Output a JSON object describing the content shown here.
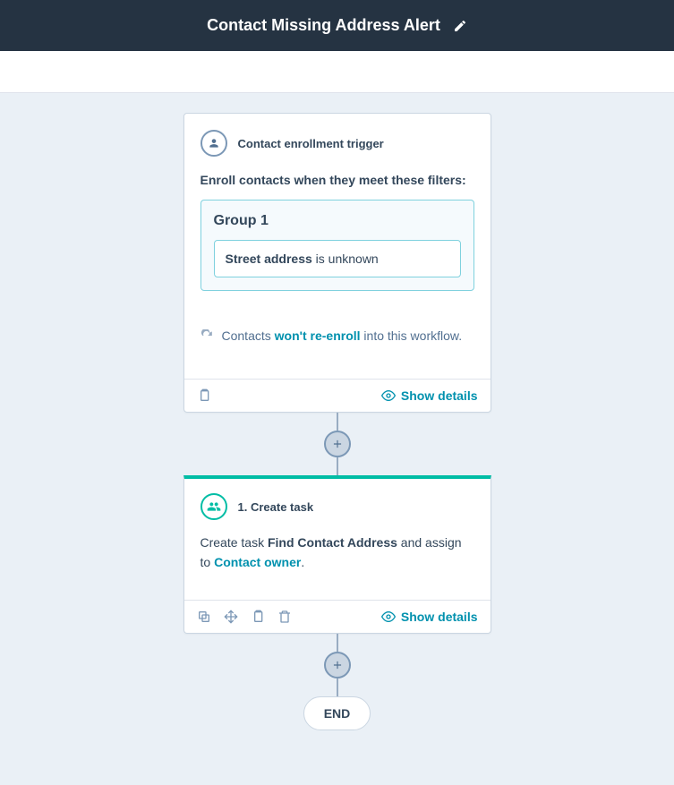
{
  "header": {
    "title": "Contact Missing Address Alert"
  },
  "trigger": {
    "title": "Contact enrollment trigger",
    "description": "Enroll contacts when they meet these filters:",
    "group": {
      "title": "Group 1",
      "filter_property": "Street address",
      "filter_condition": " is unknown"
    },
    "reenroll_prefix": "Contacts ",
    "reenroll_highlight": "won't re-enroll",
    "reenroll_suffix": " into this workflow.",
    "show_details_label": "Show details"
  },
  "action": {
    "title": "1. Create task",
    "text_prefix": "Create task ",
    "task_name": "Find Contact Address",
    "text_mid": " and assign to ",
    "assignee": "Contact owner",
    "text_suffix": ".",
    "show_details_label": "Show details"
  },
  "end_label": "END"
}
